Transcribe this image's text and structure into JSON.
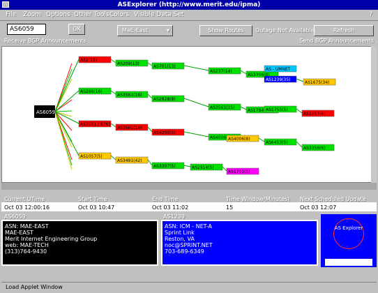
{
  "window": {
    "title": "ASExplorer (http://www.merit.edu/ipma)"
  },
  "menubar": {
    "items": [
      "File",
      "Zoom",
      "Options",
      "Other Tools",
      "Colors",
      "Visible Data Set"
    ],
    "help": "?"
  },
  "toolbar": {
    "as_input": "AS6059",
    "ok_label": "OK",
    "mode_select": "MaE-East",
    "show_routes_label": "Show Routes",
    "outage_label": "Outage Not Available",
    "refresh_label": "Refresh"
  },
  "graph": {
    "left_label": "Receive BGP Announcements",
    "right_label": "Send BGP Announcements",
    "root": "AS6059",
    "nodes": [
      {
        "label": "AS1(12)",
        "color": "#ff0000"
      },
      {
        "label": "AS209(13)",
        "color": "#00e000"
      },
      {
        "label": "AS701(13)",
        "color": "#00e000"
      },
      {
        "label": "AS237(14)",
        "color": "#00e000"
      },
      {
        "label": "AS3356(8)",
        "color": "#00e000"
      },
      {
        "label": "AS - UMNET",
        "color": "#00c8ff"
      },
      {
        "label": "AS1239(35)",
        "color": "#0000ff"
      },
      {
        "label": "AS1675(34)",
        "color": "#ffc800"
      },
      {
        "label": "AS286(16)",
        "color": "#00e000"
      },
      {
        "label": "AS3561(16)",
        "color": "#00e000"
      },
      {
        "label": "AS2828(8)",
        "color": "#00e000"
      },
      {
        "label": "AS3561(15)",
        "color": "#00e000"
      },
      {
        "label": "AS1784(5)",
        "color": "#00e000"
      },
      {
        "label": "AS1755(5)",
        "color": "#00e000"
      },
      {
        "label": "AS1257(6)",
        "color": "#ff0000"
      },
      {
        "label": "AS3561 / 6761",
        "color": "#ff0000"
      },
      {
        "label": "AS3561(14)",
        "color": "#ff0000"
      },
      {
        "label": "AS4200(5)",
        "color": "#ff0000"
      },
      {
        "label": "AS4006(32)",
        "color": "#00e000"
      },
      {
        "label": "AS4006(8)",
        "color": "#ffc800"
      },
      {
        "label": "AS6453(5)",
        "color": "#00e000"
      },
      {
        "label": "AS3356(6)",
        "color": "#00e000"
      },
      {
        "label": "AS1057(5)",
        "color": "#ffc800"
      },
      {
        "label": "AS3491(42)",
        "color": "#ffc800"
      },
      {
        "label": "AS3307(5)",
        "color": "#00e000"
      },
      {
        "label": "AS2914(5)",
        "color": "#00e000"
      },
      {
        "label": "AS1701(5)",
        "color": "#ff00ff"
      }
    ]
  },
  "times": {
    "headers": [
      "Current UTime",
      "Start Time",
      "End Time",
      "Time Window(Minutes)",
      "Next Scheduled Update"
    ],
    "values": [
      "Oct 03 12:00:16",
      "Oct 03 10:47",
      "Oct 03 11:02",
      "15",
      "Oct 03 12:07"
    ]
  },
  "panels": {
    "left_title": "AS6059",
    "left_lines": [
      "ASN: MAE-EAST",
      "MAE-EAST",
      "Merit Internet Engineering Group",
      "web: MAE-TECH",
      "(313)764-9430"
    ],
    "mid_title": "AS1239",
    "mid_lines": [
      "ASN: ICM - NET-A",
      "Sprint Link",
      "Reston, VA",
      "noc@SPRINT.NET",
      "703-689-6349"
    ],
    "logo_text": "AS Explorer"
  },
  "status": {
    "text": "Load Applet Window"
  }
}
